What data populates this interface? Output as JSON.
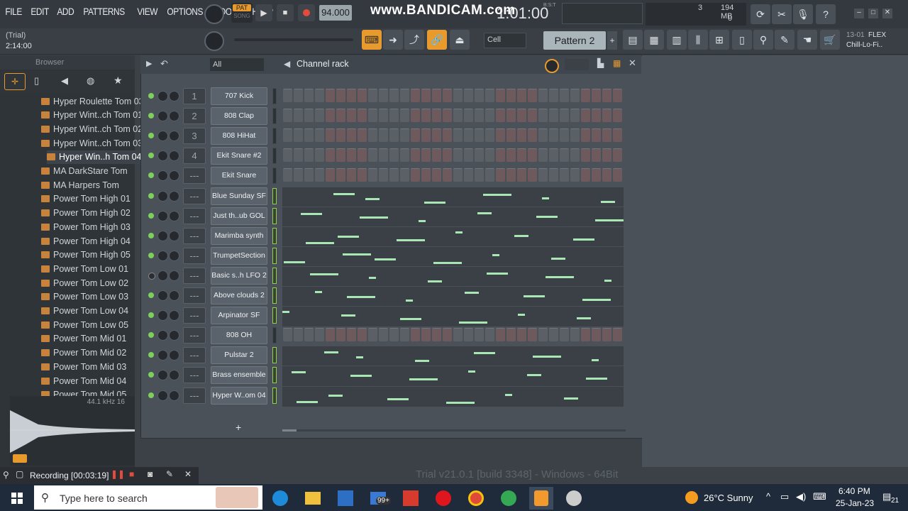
{
  "menu": [
    "FILE",
    "EDIT",
    "ADD",
    "PATTERNS",
    "VIEW",
    "OPTIONS",
    "TOOLS",
    "HELP"
  ],
  "transport": {
    "pat_label": "PAT",
    "song_label": "SONG",
    "tempo": "94.000",
    "time": "1:01:00",
    "bst": "B:S:T"
  },
  "watermark": "www.BANDICAM.com",
  "info": {
    "trial": "(Trial)",
    "time": "2:14:00"
  },
  "cpu": {
    "value": "3",
    "mem": "194 MB",
    "zero": "0"
  },
  "pattern": {
    "snap": "Cell",
    "name": "Pattern 2"
  },
  "project": {
    "date": "13-01",
    "flex": "FLEX",
    "preset": "Chill-Lo-Fi.."
  },
  "browser": {
    "title": "Browser",
    "items": [
      "Hyper Roulette Tom 03",
      "Hyper Wint..ch Tom 01",
      "Hyper Wint..ch Tom 02",
      "Hyper Wint..ch Tom 03",
      "Hyper Win..h Tom 04",
      "MA DarkStare Tom",
      "MA Harpers Tom",
      "Power Tom High 01",
      "Power Tom High 02",
      "Power Tom High 03",
      "Power Tom High 04",
      "Power Tom High 05",
      "Power Tom Low 01",
      "Power Tom Low 02",
      "Power Tom Low 03",
      "Power Tom Low 04",
      "Power Tom Low 05",
      "Power Tom Mid 01",
      "Power Tom Mid 02",
      "Power Tom Mid 03",
      "Power Tom Mid 04",
      "Power Tom Mid 05"
    ],
    "sample_rate": "44.1 kHz 16"
  },
  "rack": {
    "filter": "All",
    "title": "Channel rack",
    "add": "+",
    "channels": [
      {
        "num": "1",
        "name": "707 Kick",
        "type": "steps"
      },
      {
        "num": "2",
        "name": "808 Clap",
        "type": "steps"
      },
      {
        "num": "3",
        "name": "808 HiHat",
        "type": "steps"
      },
      {
        "num": "4",
        "name": "Ekit Snare #2",
        "type": "steps"
      },
      {
        "num": "---",
        "name": "Ekit Snare",
        "type": "steps"
      },
      {
        "num": "---",
        "name": "Blue Sunday SF",
        "type": "piano"
      },
      {
        "num": "---",
        "name": "Just th..ub GOL",
        "type": "piano"
      },
      {
        "num": "---",
        "name": "Marimba synth",
        "type": "piano"
      },
      {
        "num": "---",
        "name": "TrumpetSection",
        "type": "piano"
      },
      {
        "num": "---",
        "name": "Basic s..h LFO 2",
        "type": "piano"
      },
      {
        "num": "---",
        "name": "Above clouds 2",
        "type": "piano"
      },
      {
        "num": "---",
        "name": "Arpinator SF",
        "type": "piano"
      },
      {
        "num": "---",
        "name": "808 OH",
        "type": "steps"
      },
      {
        "num": "---",
        "name": "Pulstar 2",
        "type": "piano"
      },
      {
        "num": "---",
        "name": "Brass ensemble",
        "type": "piano"
      },
      {
        "num": "---",
        "name": "Hyper W..om 04",
        "type": "piano"
      }
    ]
  },
  "version": "Trial v21.0.1 [build 3348] - Windows - 64Bit",
  "recording": "Recording [00:03:19]",
  "taskbar": {
    "search": "Type here to search",
    "weather": "26°C Sunny",
    "time": "6:40 PM",
    "date": "25-Jan-23",
    "badge": "99+",
    "notif": "21"
  }
}
